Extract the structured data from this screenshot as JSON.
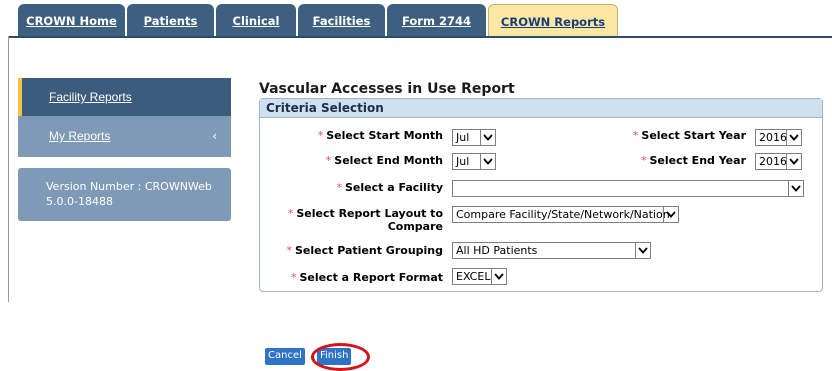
{
  "tabs": [
    {
      "label": "CROWN Home"
    },
    {
      "label": "Patients"
    },
    {
      "label": "Clinical"
    },
    {
      "label": "Facilities"
    },
    {
      "label": "Form 2744"
    },
    {
      "label": "CROWN Reports"
    }
  ],
  "sidebar": {
    "facility_reports": "Facility Reports",
    "my_reports": "My Reports",
    "chevron": "‹",
    "version_line1": "Version Number : CROWNWeb",
    "version_line2": "5.0.0-18488"
  },
  "report": {
    "title": "Vascular Accesses in Use Report",
    "criteria_header": "Criteria Selection",
    "required_mark": "*",
    "start_month_label": "Select Start Month",
    "start_month_value": "Jul",
    "start_year_label": "Select Start Year",
    "start_year_value": "2016",
    "end_month_label": "Select End Month",
    "end_month_value": "Jul",
    "end_year_label": "Select End Year",
    "end_year_value": "2016",
    "facility_label": "Select a Facility",
    "facility_value": "",
    "layout_label_line1": "Select Report Layout to",
    "layout_label_line2": "Compare",
    "layout_value": "Compare Facility/State/Network/Nation",
    "grouping_label": "Select Patient Grouping",
    "grouping_value": "All HD Patients",
    "format_label": "Select a Report Format",
    "format_value": "EXCEL"
  },
  "buttons": {
    "cancel": "Cancel",
    "finish": "Finish"
  },
  "colors": {
    "tab_dark": "#3d5f80",
    "tab_active": "#fce7a4",
    "nav_active": "#3c5c7e",
    "nav_inactive": "#7f9ab6",
    "accent_gold": "#f6c342",
    "button_blue": "#2f73c4",
    "highlight_circle": "#d4141c"
  }
}
